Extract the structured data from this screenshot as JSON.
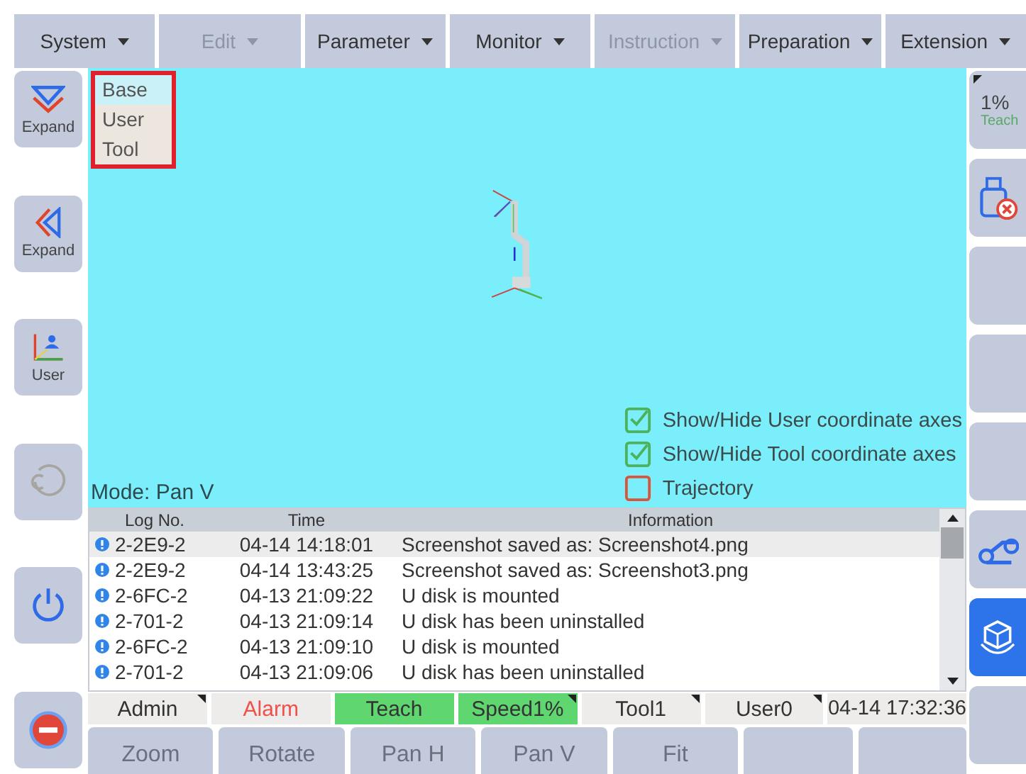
{
  "menu": [
    {
      "label": "System",
      "disabled": false
    },
    {
      "label": "Edit",
      "disabled": true
    },
    {
      "label": "Parameter",
      "disabled": false
    },
    {
      "label": "Monitor",
      "disabled": false
    },
    {
      "label": "Instruction",
      "disabled": true
    },
    {
      "label": "Preparation",
      "disabled": false
    },
    {
      "label": "Extension",
      "disabled": false
    }
  ],
  "left_buttons": [
    {
      "kind": "expand-down",
      "label": "Expand"
    },
    {
      "kind": "expand-left",
      "label": "Expand"
    },
    {
      "kind": "user-frame",
      "label": "User"
    },
    {
      "kind": "cycle"
    },
    {
      "kind": "power"
    },
    {
      "kind": "ini"
    }
  ],
  "coordinate_menu": [
    {
      "label": "Base",
      "selected": true
    },
    {
      "label": "User",
      "selected": false
    },
    {
      "label": "Tool",
      "selected": false
    }
  ],
  "mode": "Mode: Pan V",
  "options": [
    {
      "label": "Show/Hide User coordinate axes",
      "checked": true
    },
    {
      "label": "Show/Hide Tool coordinate axes",
      "checked": true
    },
    {
      "label": "Trajectory",
      "checked": false
    }
  ],
  "log": {
    "columns": [
      "Log No.",
      "Time",
      "Information"
    ],
    "rows": [
      {
        "log_no": "2-2E9-2",
        "time": "04-14 14:18:01",
        "information": "Screenshot saved as: Screenshot4.png",
        "selected": true
      },
      {
        "log_no": "2-2E9-2",
        "time": "04-14 13:43:25",
        "information": "Screenshot saved as: Screenshot3.png",
        "selected": false
      },
      {
        "log_no": "2-6FC-2",
        "time": "04-13 21:09:22",
        "information": "U disk is mounted",
        "selected": false
      },
      {
        "log_no": "2-701-2",
        "time": "04-13 21:09:14",
        "information": "U disk has been uninstalled",
        "selected": false
      },
      {
        "log_no": "2-6FC-2",
        "time": "04-13 21:09:10",
        "information": "U disk is mounted",
        "selected": false
      },
      {
        "log_no": "2-701-2",
        "time": "04-13 21:09:06",
        "information": "U disk has been uninstalled",
        "selected": false
      }
    ]
  },
  "status_bar": [
    {
      "label": "Admin",
      "active": false,
      "alarm": false,
      "menu": true
    },
    {
      "label": "Alarm",
      "active": false,
      "alarm": true,
      "menu": false
    },
    {
      "label": "Teach",
      "active": true,
      "alarm": false,
      "menu": false
    },
    {
      "label": "Speed1%",
      "active": true,
      "alarm": false,
      "menu": true
    },
    {
      "label": "Tool1",
      "active": false,
      "alarm": false,
      "menu": true
    },
    {
      "label": "User0",
      "active": false,
      "alarm": false,
      "menu": true
    },
    {
      "label": "04-14 17:32:36",
      "active": false,
      "alarm": false,
      "menu": false
    }
  ],
  "view_buttons": [
    "Zoom",
    "Rotate",
    "Pan H",
    "Pan V",
    "Fit"
  ],
  "right_panel": {
    "speed": "1%",
    "mode": "Teach"
  },
  "right_buttons": [
    {
      "kind": "usb-error"
    },
    {
      "kind": "blank"
    },
    {
      "kind": "blank"
    },
    {
      "kind": "blank"
    },
    {
      "kind": "robot"
    },
    {
      "kind": "view-3d"
    },
    {
      "kind": "blank"
    }
  ]
}
